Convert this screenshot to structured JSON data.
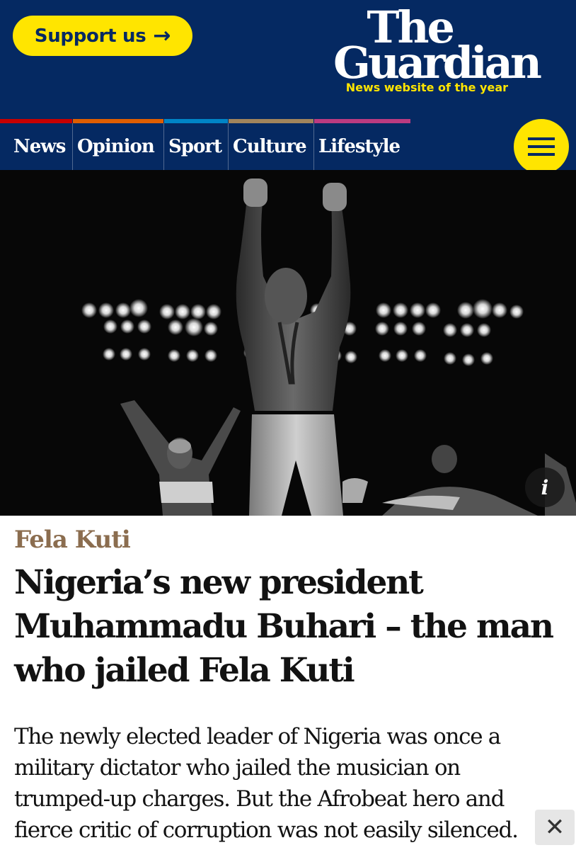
{
  "header": {
    "support_label": "Support us",
    "logo_line1": "The",
    "logo_line2": "Guardian",
    "tagline": "News website of the year"
  },
  "nav": {
    "items": [
      {
        "label": "News",
        "color": "#c70000"
      },
      {
        "label": "Opinion",
        "color": "#e05e00"
      },
      {
        "label": "Sport",
        "color": "#0084c6"
      },
      {
        "label": "Culture",
        "color": "#a1845c"
      },
      {
        "label": "Lifestyle",
        "color": "#bb3b80"
      }
    ],
    "menu_icon": "hamburger-icon"
  },
  "colors": {
    "brand_blue": "#052962",
    "brand_yellow": "#ffe500",
    "kicker": "#8b6d4f",
    "text": "#121212"
  },
  "hero": {
    "alt": "Black and white concert photo",
    "info_icon": "info-icon",
    "info_label": "i"
  },
  "article": {
    "kicker": "Fela Kuti",
    "headline_lines": [
      "Nigeria’s new president",
      "Muhammadu Buhari – the man",
      "who jailed Fela Kuti"
    ],
    "standfirst_lines": [
      "The newly elected leader of Nigeria was once a",
      "military dictator who jailed the musician on",
      "trumped-up charges. But the Afrobeat hero and",
      "fierce critic of corruption was not easily silenced."
    ]
  },
  "close_label": "✕"
}
